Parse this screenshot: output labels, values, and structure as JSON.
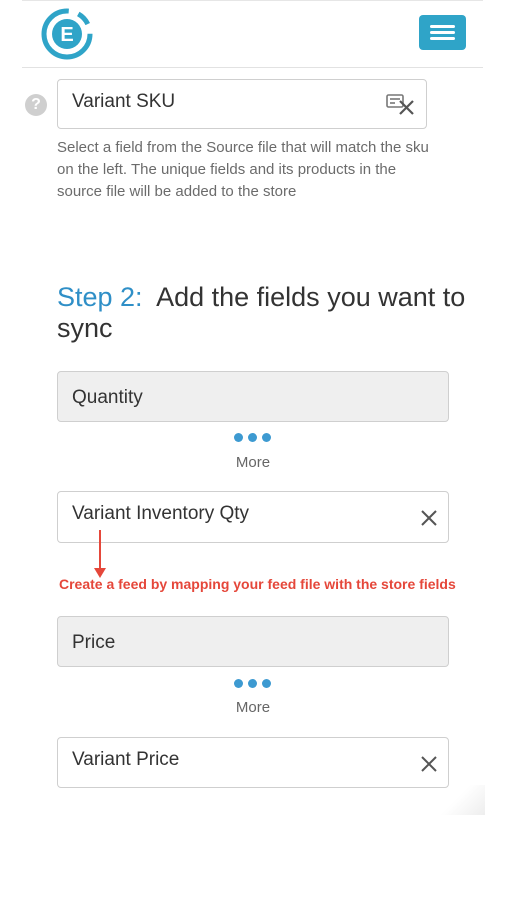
{
  "header": {
    "logo_letter": "E",
    "logo_color": "#2fa4c8",
    "menu_icon": "hamburger-icon"
  },
  "source_match": {
    "field_value": "Variant SKU",
    "help_text": "Select a field from the Source file that will match the sku on the left. The unique fields and its products in the source file will be added to the store"
  },
  "step2": {
    "step_label": "Step 2:",
    "title": "Add the fields you want to sync"
  },
  "mappings": [
    {
      "store_field": "Quantity",
      "more_label": "More",
      "source_field": "Variant Inventory Qty"
    },
    {
      "store_field": "Price",
      "more_label": "More",
      "source_field": "Variant Price"
    }
  ],
  "annotation": {
    "text": "Create a feed by mapping your feed file with the store fields",
    "color": "#e5473a"
  }
}
